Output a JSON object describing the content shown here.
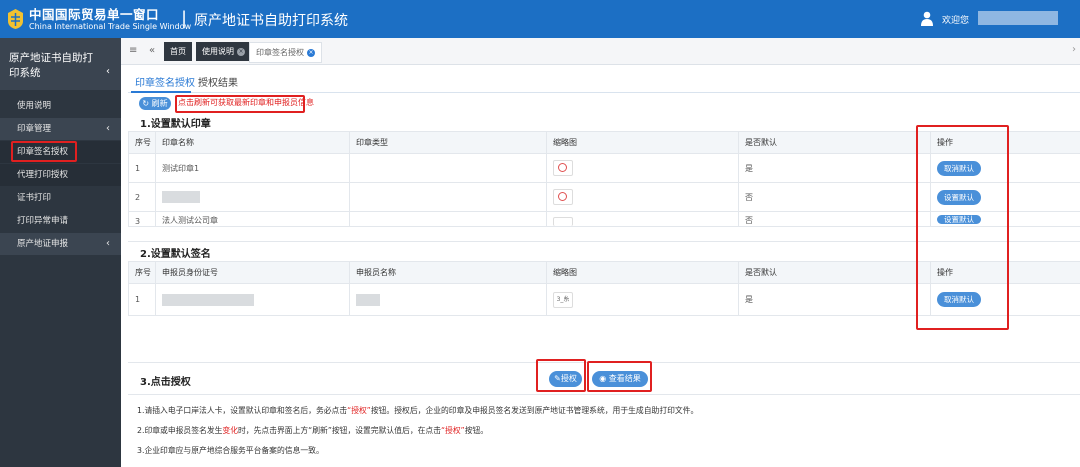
{
  "header": {
    "brand_cn": "中国国际贸易单一窗口",
    "brand_en": "China International Trade Single Window",
    "system_title": "原产地证书自助打印系统",
    "welcome": "欢迎您",
    "colors": {
      "topbar": "#1c6fc4",
      "sidebar": "#2d3640",
      "accent": "#4a90d9",
      "highlight": "#e02020"
    }
  },
  "sidebar": {
    "title": "原产地证书自助打印系统",
    "items": [
      {
        "label": "使用说明"
      },
      {
        "label": "印章管理"
      },
      {
        "label": "印章签名授权"
      },
      {
        "label": "代理打印授权"
      },
      {
        "label": "证书打印"
      },
      {
        "label": "打印异常申请"
      },
      {
        "label": "原产地证申报"
      }
    ]
  },
  "tabbar": {
    "tabs": [
      {
        "label": "首页"
      },
      {
        "label": "使用说明"
      },
      {
        "label": "印章签名授权"
      }
    ]
  },
  "subtabs": {
    "active": "印章签名授权",
    "other": "授权结果"
  },
  "refresh": {
    "label": "刷新",
    "note": "点击刷新可获取最新印章和申报员信息"
  },
  "seals": {
    "title": "1.设置默认印章",
    "headers": [
      "序号",
      "印章名称",
      "印章类型",
      "缩略图",
      "是否默认",
      "操作"
    ],
    "rows": [
      {
        "no": "1",
        "name": "测试印章1",
        "default": "是",
        "action": "取消默认"
      },
      {
        "no": "2",
        "name": "",
        "default": "否",
        "action": "设置默认"
      },
      {
        "no": "3",
        "name": "法人测试公司章",
        "default": "否",
        "action": "设置默认"
      }
    ]
  },
  "signatures": {
    "title": "2.设置默认签名",
    "headers": [
      "序号",
      "申报员身份证号",
      "申报员名称",
      "缩略图",
      "是否默认",
      "操作"
    ],
    "rows": [
      {
        "no": "1",
        "thumb": "3_糸",
        "default": "是",
        "action": "取消默认"
      }
    ]
  },
  "authorize": {
    "title": "3.点击授权",
    "auth_button": "授权",
    "result_button": "查看结果",
    "instructions": [
      {
        "pre": "1.请插入电子口岸法人卡，设置默认印章和签名后，务必点击",
        "em": "“授权”",
        "post": "按钮。授权后，企业的印章及申报员签名发送到原产地证书管理系统，用于生成自助打印文件。"
      },
      {
        "pre": "2.印章或申报员签名发生",
        "em": "变化",
        "mid": "时，先点击界面上方“刷新”按钮，设置完默认值后，在点击",
        "em2": "“授权”",
        "post": "按钮。"
      },
      {
        "pre": "3.企业印章应与原产地综合服务平台备案的信息一致。"
      }
    ]
  }
}
